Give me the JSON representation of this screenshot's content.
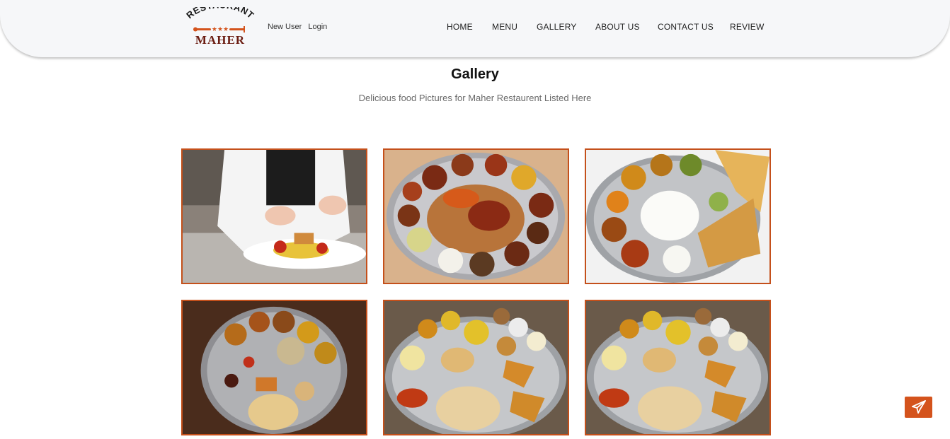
{
  "header": {
    "logo": {
      "top_text": "RESTAURANT",
      "bottom_text": "MAHER",
      "stars": "★★★"
    },
    "user_links": {
      "new_user": "New User",
      "login": "Login"
    },
    "nav": [
      {
        "label": "HOME"
      },
      {
        "label": "MENU"
      },
      {
        "label": "GALLERY"
      },
      {
        "label": "ABOUT US"
      },
      {
        "label": "CONTACT US"
      },
      {
        "label": "REVIEW"
      }
    ]
  },
  "main": {
    "title": "Gallery",
    "subtitle": "Delicious food Pictures for Maher Restaurent Listed Here"
  },
  "gallery": [
    {
      "icon": "chef-plating-photo"
    },
    {
      "icon": "thali-platter-photo"
    },
    {
      "icon": "thali-rice-roti-photo"
    },
    {
      "icon": "thali-poori-photo"
    },
    {
      "icon": "thali-samosa-photo"
    },
    {
      "icon": "thali-samosa-photo"
    }
  ],
  "floating_button": {
    "icon": "send-icon"
  },
  "colors": {
    "accent": "#c4501b",
    "button": "#d4531c",
    "header_bg": "#f6f7f9",
    "logo_text": "#6b1d12"
  }
}
